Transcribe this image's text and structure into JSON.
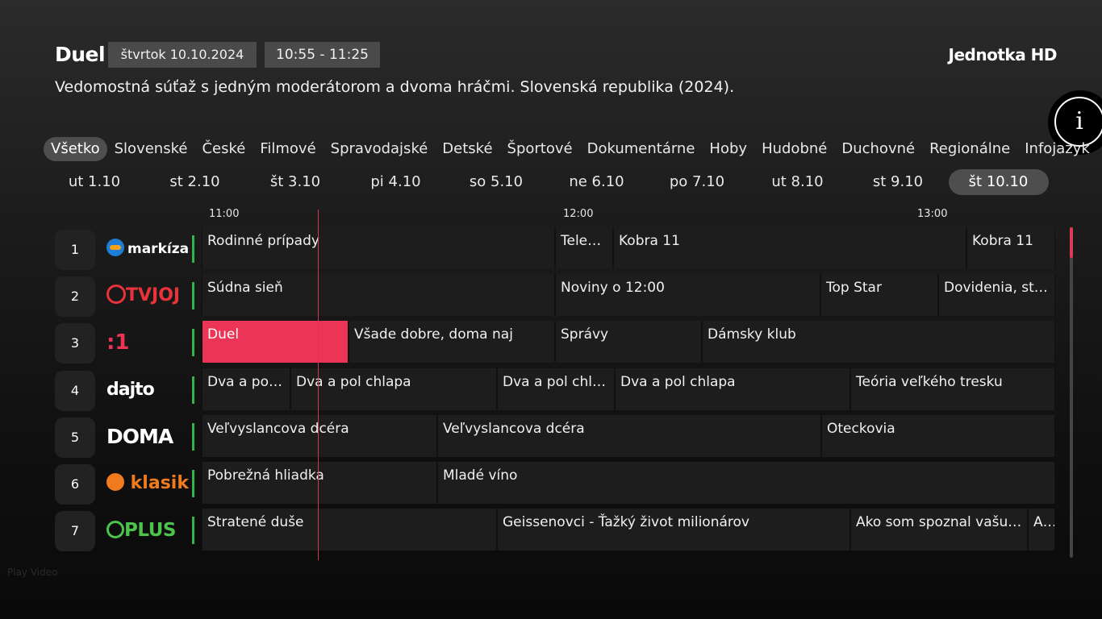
{
  "detail": {
    "title": "Duel",
    "date": "štvrtok 10.10.2024",
    "time": "10:55 - 11:25",
    "channel": "Jednotka HD",
    "description": "Vedomostná súťaž s jedným moderátorom a dvoma hráčmi. Slovenská republika (2024)."
  },
  "info_button": {
    "label": "i"
  },
  "genres": [
    "Všetko",
    "Slovenské",
    "České",
    "Filmové",
    "Spravodajské",
    "Detské",
    "Športové",
    "Dokumentárne",
    "Hoby",
    "Hudobné",
    "Duchovné",
    "Regionálne",
    "Infojazyk"
  ],
  "active_genre": 0,
  "days": [
    "ut 1.10",
    "st 2.10",
    "št 3.10",
    "pi 4.10",
    "so 5.10",
    "ne 6.10",
    "po 7.10",
    "ut 8.10",
    "st 9.10",
    "št 10.10"
  ],
  "active_day": 9,
  "ticks": [
    "11:00",
    "12:00",
    "13:00"
  ],
  "channels": [
    {
      "number": "1",
      "logo": "markiza-logo",
      "logo_text": "markíza",
      "programs": [
        "Rodinné prípady",
        "Televí…",
        "Kobra 11",
        "Kobra 11"
      ]
    },
    {
      "number": "2",
      "logo": "tvjoj-logo",
      "logo_text": "TVJOJ",
      "programs": [
        "Súdna sieň",
        "Noviny o 12:00",
        "Top Star",
        "Dovidenia, staré"
      ]
    },
    {
      "number": "3",
      "logo": "jednotka-logo",
      "logo_text": ":1",
      "programs": [
        "Duel",
        "Všade dobre, doma naj",
        "Správy",
        "Dámsky klub"
      ]
    },
    {
      "number": "4",
      "logo": "dajto-logo",
      "logo_text": "dajto",
      "programs": [
        "Dva a pol chlapa",
        "Dva a pol chlapa",
        "Dva a pol chl…",
        "Dva a pol chlapa",
        "Teória veľkého tresku"
      ]
    },
    {
      "number": "5",
      "logo": "doma-logo",
      "logo_text": "DOMA",
      "programs": [
        "Veľvyslancova dcéra",
        "Veľvyslancova dcéra",
        "Oteckovia"
      ]
    },
    {
      "number": "6",
      "logo": "klasik-logo",
      "logo_text": "klasik",
      "programs": [
        "Pobrežná hliadka",
        "Mladé víno"
      ]
    },
    {
      "number": "7",
      "logo": "plus-logo",
      "logo_text": "PLUS",
      "programs": [
        "Stratené duše",
        "Geissenovci - Ťažký život milionárov",
        "Ako som spoznal vašu …",
        "Ako"
      ]
    }
  ],
  "play_video": "Play Video",
  "colors": {
    "accent": "#ec3556",
    "now_line": "#d6384e",
    "chip": "#4a4a4a",
    "cell": "#1d1d1d"
  }
}
